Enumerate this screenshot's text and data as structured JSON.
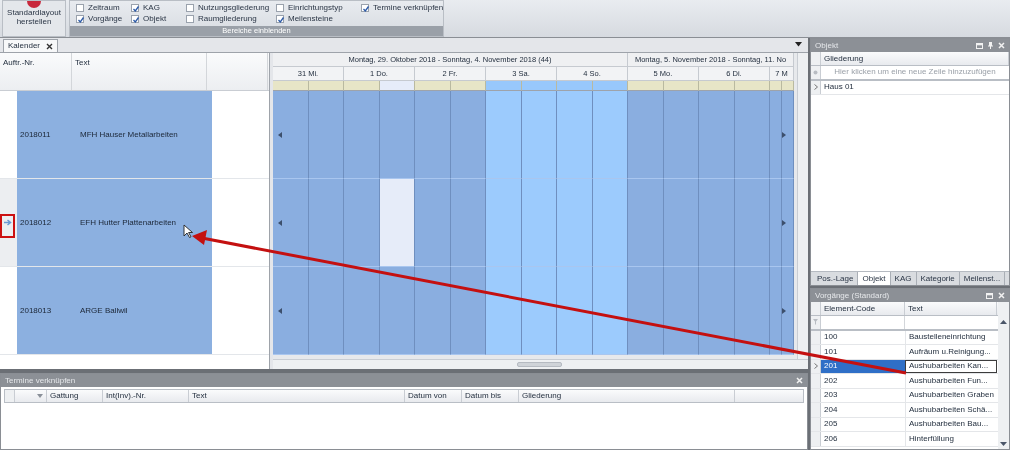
{
  "ribbon": {
    "button_label": "Standardlayout herstellen",
    "group_label": "Bereiche einblenden",
    "options": [
      {
        "label": "Zeitraum",
        "checked": false
      },
      {
        "label": "Vorgänge",
        "checked": true
      },
      {
        "label": "KAG",
        "checked": true
      },
      {
        "label": "Objekt",
        "checked": true
      },
      {
        "label": "Nutzungsgliederung",
        "checked": false
      },
      {
        "label": "Raumgliederung",
        "checked": false
      },
      {
        "label": "Einrichtungstyp",
        "checked": false
      },
      {
        "label": "Meilensteine",
        "checked": true
      },
      {
        "label": "Termine verknüpfen",
        "checked": true
      }
    ]
  },
  "document_tab": {
    "label": "Kalender"
  },
  "orders": {
    "columns": [
      "Auftr.-Nr.",
      "Text"
    ],
    "rows": [
      {
        "number": "2018011",
        "text": "MFH Hauser Metallarbeiten",
        "selected": false
      },
      {
        "number": "2018012",
        "text": "EFH Hutter Plattenarbeiten",
        "selected": true
      },
      {
        "number": "2018013",
        "text": "ARGE Ballwil",
        "selected": false
      }
    ]
  },
  "calendar": {
    "weeks": [
      {
        "label": "Montag, 29. Oktober 2018 - Sonntag, 4. November 2018 (44)",
        "days": [
          {
            "label": "31 Mi.",
            "weekend": false,
            "selected": false
          },
          {
            "label": "1 Do.",
            "weekend": false,
            "selected": true
          },
          {
            "label": "2 Fr.",
            "weekend": false,
            "selected": false
          },
          {
            "label": "3 Sa.",
            "weekend": true,
            "selected": false
          },
          {
            "label": "4 So.",
            "weekend": true,
            "selected": false
          }
        ]
      },
      {
        "label": "Montag, 5. November 2018 - Sonntag, 11. No",
        "days": [
          {
            "label": "5 Mo.",
            "weekend": false,
            "selected": false
          },
          {
            "label": "6 Di.",
            "weekend": false,
            "selected": false
          },
          {
            "label": "7 M",
            "weekend": false,
            "selected": false
          }
        ]
      }
    ]
  },
  "objekt_panel": {
    "title": "Objekt",
    "column": "Gliederung",
    "new_row_placeholder": "Hier klicken um eine neue Zeile hinzuzufügen",
    "rows": [
      {
        "label": "Haus 01",
        "current": true
      }
    ],
    "tabs": [
      {
        "label": "Pos.-Lage",
        "selected": false
      },
      {
        "label": "Objekt",
        "selected": true
      },
      {
        "label": "KAG",
        "selected": false
      },
      {
        "label": "Kategorie",
        "selected": false
      },
      {
        "label": "Meilenst...",
        "selected": false
      }
    ]
  },
  "vorgaenge_panel": {
    "title": "Vorgänge (Standard)",
    "columns": [
      "Element-Code",
      "Text"
    ],
    "rows": [
      {
        "code": "100",
        "text": "Baustelleneinrichtung",
        "selected": false
      },
      {
        "code": "101",
        "text": "Aufräum u.Reinigung...",
        "selected": false
      },
      {
        "code": "201",
        "text": "Aushubarbeiten Kan...",
        "selected": true
      },
      {
        "code": "202",
        "text": "Aushubarbeiten Fun...",
        "selected": false
      },
      {
        "code": "203",
        "text": "Aushubarbeiten Graben",
        "selected": false
      },
      {
        "code": "204",
        "text": "Aushubarbeiten Schä...",
        "selected": false
      },
      {
        "code": "205",
        "text": "Aushubarbeiten Bau...",
        "selected": false
      },
      {
        "code": "206",
        "text": "Hinterfüllung",
        "selected": false
      }
    ]
  },
  "termine_panel": {
    "title": "Termine verknüpfen",
    "columns": [
      "Gattung",
      "Int(Inv).-Nr.",
      "Text",
      "Datum von",
      "Datum bis",
      "Gliederung"
    ]
  }
}
